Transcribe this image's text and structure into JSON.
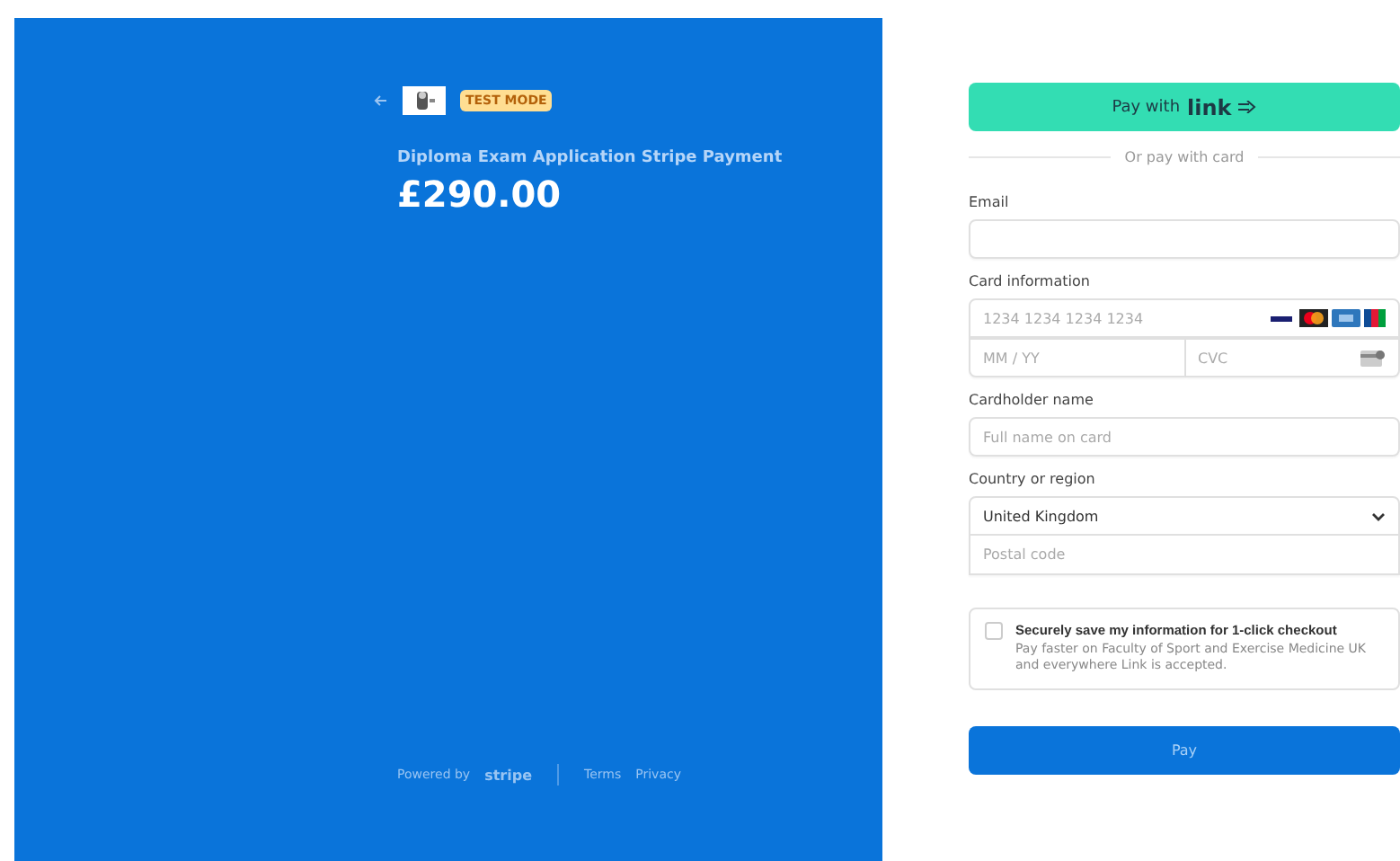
{
  "summary": {
    "badge": "TEST MODE",
    "product": "Diploma Exam Application Stripe Payment",
    "price": "£290.00"
  },
  "footer": {
    "powered": "Powered by",
    "brand": "stripe",
    "links": [
      "Terms",
      "Privacy"
    ]
  },
  "form": {
    "link_button": {
      "label": "Pay with",
      "brand": "link"
    },
    "divider": "Or pay with card",
    "email": {
      "label": "Email"
    },
    "card": {
      "label": "Card information",
      "number_placeholder": "1234 1234 1234 1234",
      "expiry_placeholder": "MM / YY",
      "cvc_placeholder": "CVC"
    },
    "cardholder": {
      "label": "Cardholder name",
      "placeholder": "Full name on card"
    },
    "country": {
      "label": "Country or region",
      "value": "United Kingdom",
      "postal_placeholder": "Postal code"
    },
    "save": {
      "checked": false,
      "title": "Securely save my information for 1-click checkout",
      "text": "Pay faster on Faculty of Sport and Exercise Medicine UK and everywhere Link is accepted."
    },
    "pay_button": "Pay"
  }
}
